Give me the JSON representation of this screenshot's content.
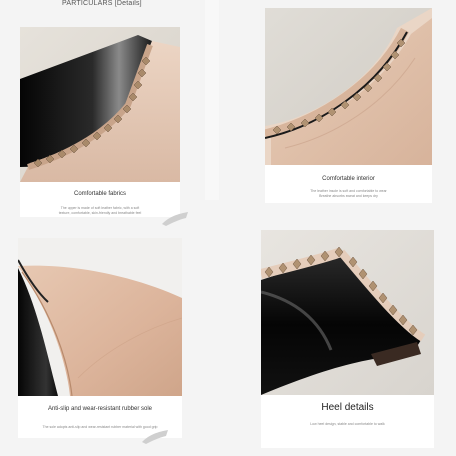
{
  "header": {
    "label": "PARTICULARS [Details]"
  },
  "panels": [
    {
      "title": "Comfortable fabrics",
      "desc_1": "The upper is made of soft leather fabric, with a soft",
      "desc_2": "texture, comfortable, skin-friendly and breathable feel"
    },
    {
      "title": "Comfortable interior",
      "desc_1": "The leather insole is soft and comfortable to wear",
      "desc_2": "Breathe absorbs sweat and keeps dry"
    },
    {
      "title": "Anti-slip and wear-resistant rubber sole",
      "desc_1": "The sole adopts anti-slip and wear-resistant rubber material with good grip"
    },
    {
      "title": "Heel details",
      "desc_1": "Low heel design, stable and comfortable to walk"
    }
  ]
}
